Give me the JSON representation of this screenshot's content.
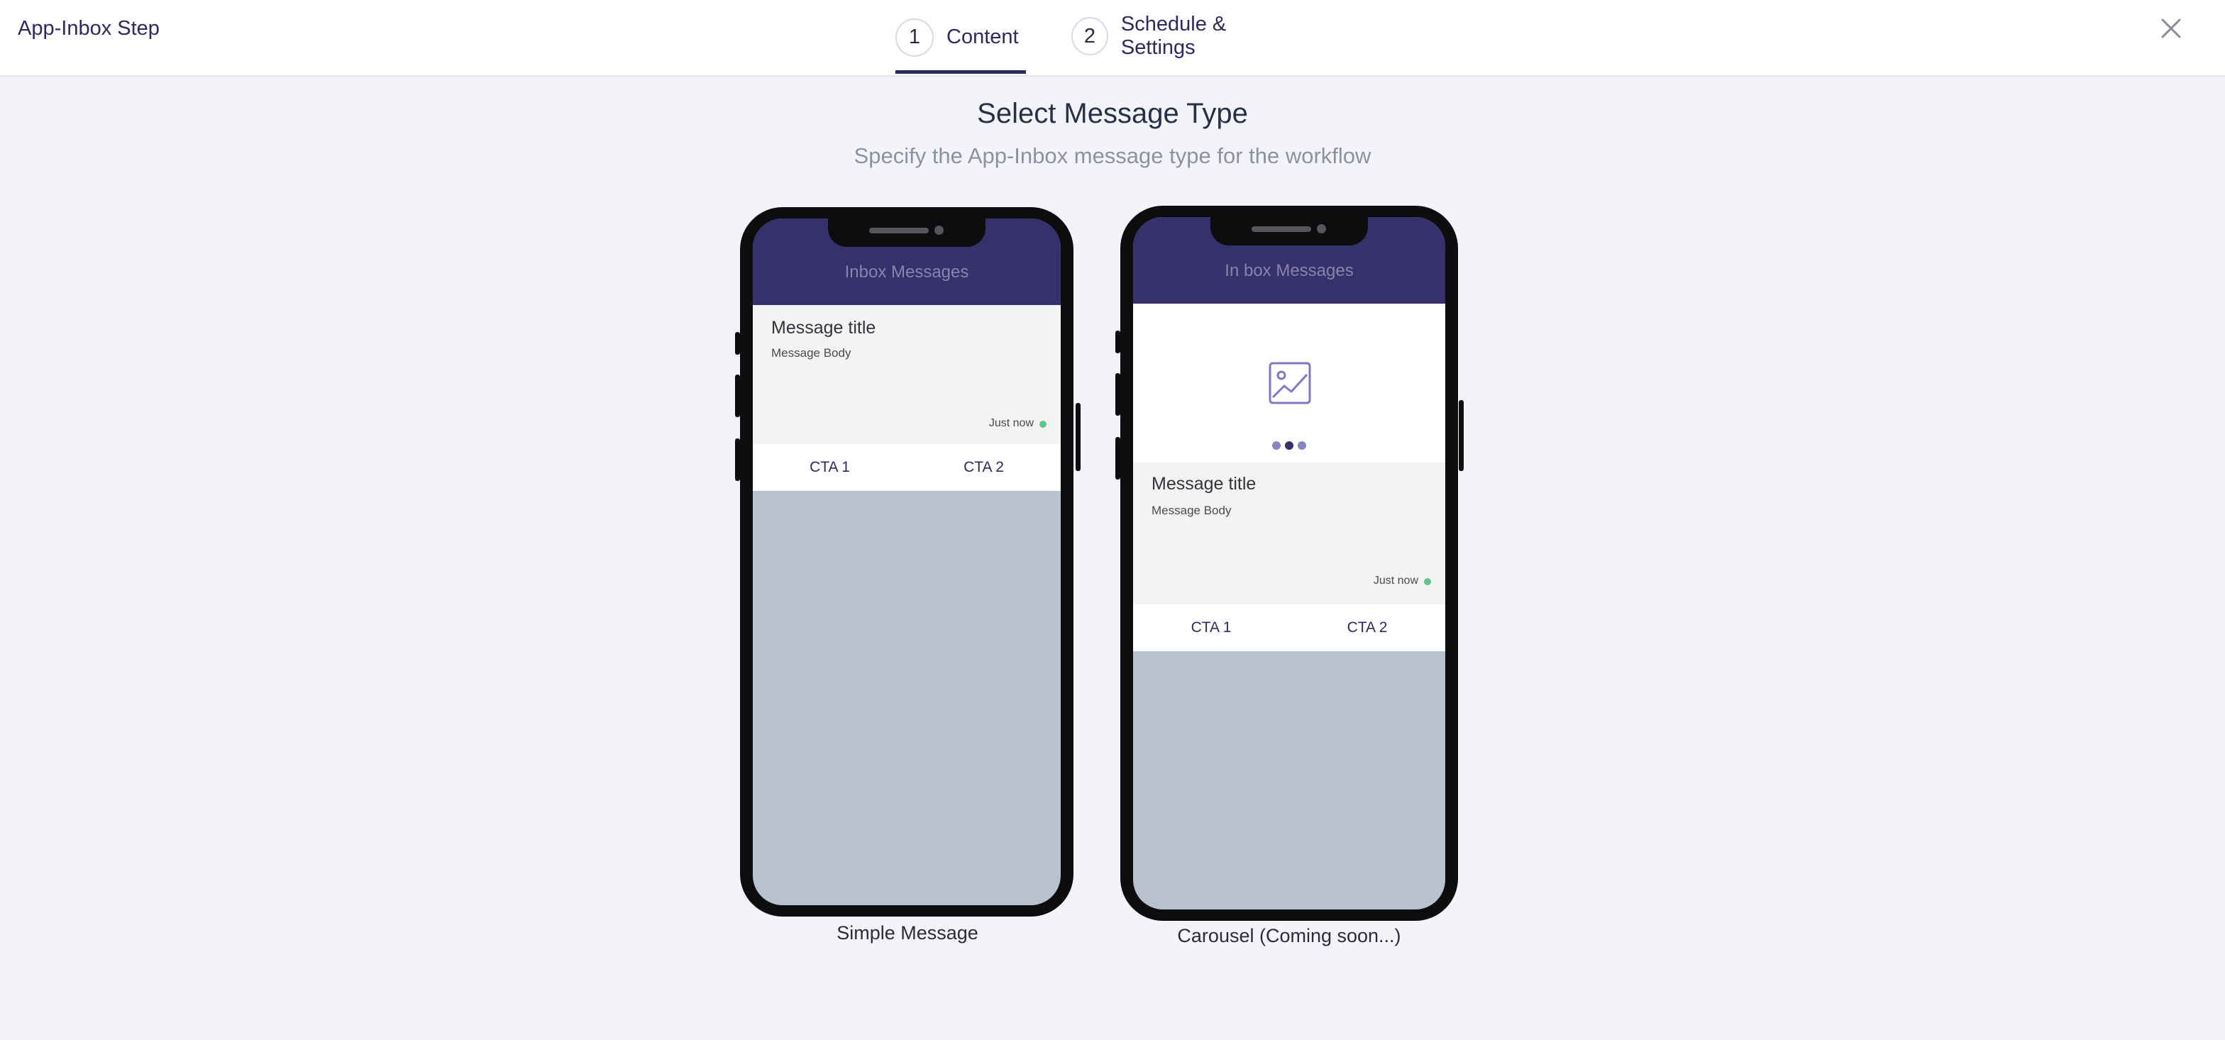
{
  "header": {
    "app_title": "App-Inbox Step",
    "steps": [
      {
        "number": "1",
        "label": "Content",
        "active": true
      },
      {
        "number": "2",
        "label": "Schedule & Settings",
        "active": false
      }
    ],
    "close_icon": "close-icon"
  },
  "main": {
    "title": "Select Message Type",
    "subtitle": "Specify the App-Inbox message type for the workflow"
  },
  "options": [
    {
      "caption": "Simple Message",
      "inbox_header": "Inbox Messages",
      "message_title": "Message title",
      "message_body": "Message Body",
      "timestamp": "Just now",
      "cta_1": "CTA 1",
      "cta_2": "CTA 2"
    },
    {
      "caption": "Carousel (Coming soon...)",
      "inbox_header": "In box Messages",
      "image_icon": "image-placeholder-icon",
      "carousel_slide_count": 3,
      "carousel_active_index": 1,
      "message_title": "Message title",
      "message_body": "Message Body",
      "timestamp": "Just now",
      "cta_1": "CTA 1",
      "cta_2": "CTA 2"
    }
  ],
  "colors": {
    "brand": "#2d2a5c",
    "phone_header": "#36306b",
    "status_dot": "#5fc58a",
    "background": "#f3f4f9"
  }
}
